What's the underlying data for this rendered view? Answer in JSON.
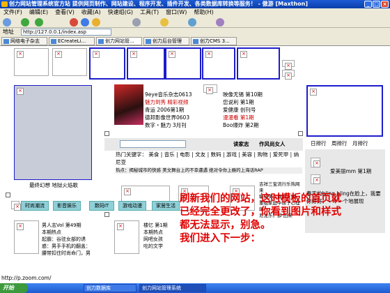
{
  "window": {
    "title": "创力网站管理系统官方站 提供网页制作、网站建设、程序开发、插件开发、各类数据库转换等服务！ - 傲游 [Maxthon]",
    "buttons": [
      "_",
      "□",
      "×"
    ]
  },
  "menu": [
    "文件(F)",
    "编辑(E)",
    "查看(V)",
    "收藏(A)",
    "快速组(G)",
    "工具(T)",
    "窗口(W)",
    "帮助(H)"
  ],
  "address": {
    "label": "地址",
    "value": "http://127.0.0.1/index.asp"
  },
  "tabs": [
    "网络电子杂志",
    "ECreateLi...",
    "创力网站管...",
    "创力后台管理",
    "创力CMS 3..."
  ],
  "magazine": {
    "lines": [
      "9eye音乐杂志0613",
      "魅力到秀 精彩视频",
      "青运 2006第1期",
      "德邦影像世界0603",
      "数字・魅力 3月刊"
    ]
  },
  "magazine2": {
    "lines": [
      "映像无锡 第10期",
      "您说利 第1期",
      "爱健康 创刊号",
      "漫漫看 第1期",
      "Boo爆炸 第2期"
    ]
  },
  "header_links": {
    "read": "读家志",
    "author": "作风尚女人"
  },
  "hotwords": {
    "label": "热门关键字：",
    "items": [
      "美食",
      "音乐",
      "电影",
      "文友",
      "数码",
      "游戏",
      "美容",
      "购物",
      "爱死甲",
      "纳尼亚"
    ]
  },
  "hotnews": "热点：揭秘城市的快感  美文舞台上的不幸遭遇  绝对令你上瘾的上海话RAP",
  "ranking": {
    "day": "日排行",
    "week": "周排行",
    "month": "月排行"
  },
  "right_item": "爱美丽mm 第1期",
  "right_text": "春天的bling bling在脸上，我要你好好，一个一个地展现",
  "mid_text": [
    "吉祥三宝流行乐热网来",
    "联邦美女摄影大赛",
    "重组家庭中孩子心理的",
    "尼龙乐，那 回来"
  ],
  "left_caption": "最终幻想 地狱火焰歌",
  "nav": [
    "时尚潮流",
    "影音娱乐",
    "数码IT",
    "游戏动漫",
    "家居生活"
  ],
  "bottom_left": [
    "男人志Vol 第49期",
    "本期热点",
    "起霸：谷驻女部的诱",
    "惑：男手手机的翻盖：",
    "腰带扣住时尚命门，男"
  ],
  "bottom_mid": [
    "楼忆 第1期",
    "本期热点",
    "网吧女孩",
    "吃的文学"
  ],
  "instruction": [
    "刷新我们的网站，这时模板的首页就",
    "已经完全更改了，你看到图片和样式",
    "都无法显示，别急。",
    "我们进入下一步："
  ],
  "status_url": "http://p.zoom.com/",
  "taskbar": {
    "start": "开始",
    "items": [
      "创力数据库",
      "创力网站管理系统"
    ]
  }
}
